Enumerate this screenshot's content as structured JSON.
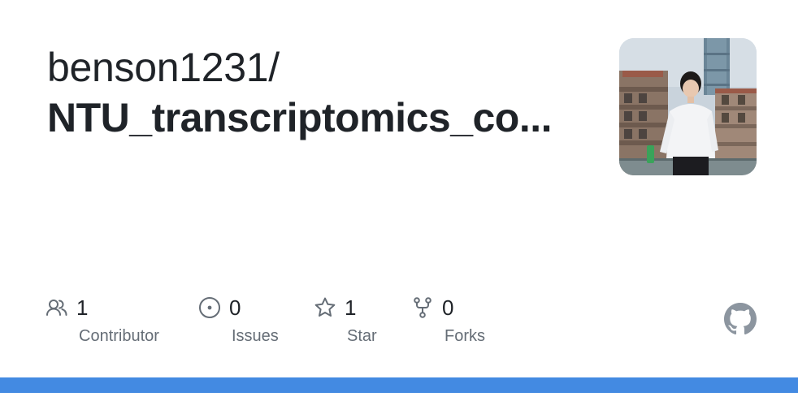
{
  "repo": {
    "owner": "benson1231/",
    "name": "NTU_transcriptomics_co..."
  },
  "avatar": {
    "icon": "user-avatar-photo"
  },
  "stats": [
    {
      "icon": "people-icon",
      "count": "1",
      "label": "Contributor"
    },
    {
      "icon": "issue-opened-icon",
      "count": "0",
      "label": "Issues"
    },
    {
      "icon": "star-icon",
      "count": "1",
      "label": "Star"
    },
    {
      "icon": "repo-forked-icon",
      "count": "0",
      "label": "Forks"
    }
  ],
  "brand": {
    "logo": "github-mark-icon"
  },
  "colors": {
    "accent_bar": "#438ae2",
    "text_primary": "#1f2328",
    "text_muted": "#656d76",
    "icon_gray": "#656d76",
    "logo_gray": "#8c959f"
  }
}
